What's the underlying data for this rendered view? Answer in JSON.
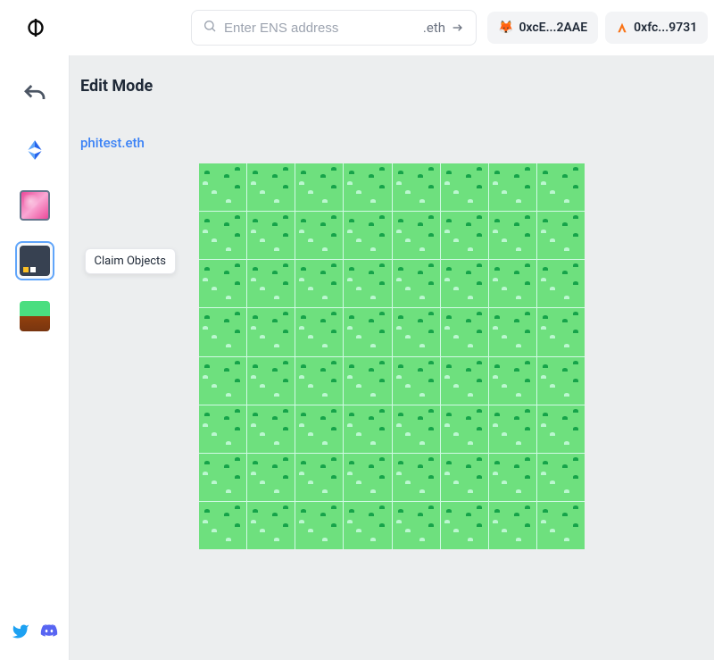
{
  "header": {
    "search_placeholder": "Enter ENS address",
    "search_suffix": ".eth",
    "wallets": [
      {
        "label": "0xcE...2AAE",
        "icon": "metamask"
      },
      {
        "label": "0xfc...9731",
        "icon": "orange-a"
      }
    ]
  },
  "sidebar": {
    "items": [
      {
        "name": "undo",
        "kind": "undo-icon"
      },
      {
        "name": "eth",
        "kind": "eth-icon"
      },
      {
        "name": "pink-object",
        "kind": "tile-pink"
      },
      {
        "name": "claim-objects",
        "kind": "tile-dark",
        "selected": true,
        "tooltip": "Claim Objects"
      },
      {
        "name": "grass-tile",
        "kind": "tile-grass"
      }
    ]
  },
  "content": {
    "mode_title": "Edit Mode",
    "ens_name": "phitest.eth",
    "grid": {
      "rows": 8,
      "cols": 8
    }
  }
}
